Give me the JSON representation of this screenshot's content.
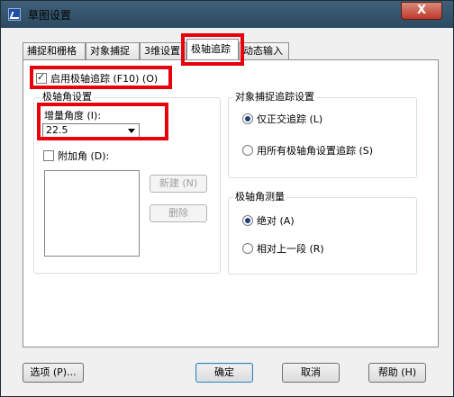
{
  "window": {
    "title": "草图设置",
    "close_glyph": "X"
  },
  "tabs": [
    {
      "label": "捕捉和栅格"
    },
    {
      "label": "对象捕捉"
    },
    {
      "label": "3维设置"
    },
    {
      "label": "极轴追踪"
    },
    {
      "label": "动态输入"
    }
  ],
  "polar": {
    "enable_label": "启用极轴追踪 (F10) (O)",
    "enable_checked": true,
    "angle_group_label": "极轴角设置",
    "increment_label": "增量角度 (I):",
    "increment_value": "22.5",
    "additional_label": "附加角 (D):",
    "additional_checked": false,
    "new_button": "新建 (N)",
    "delete_button": "删除"
  },
  "osnap_tracking": {
    "group_label": "对象捕捉追踪设置",
    "options": [
      {
        "label": "仅正交追踪 (L)",
        "selected": true
      },
      {
        "label": "用所有极轴角设置追踪 (S)",
        "selected": false
      }
    ]
  },
  "measurement": {
    "group_label": "极轴角测量",
    "options": [
      {
        "label": "绝对 (A)",
        "selected": true
      },
      {
        "label": "相对上一段 (R)",
        "selected": false
      }
    ]
  },
  "footer": {
    "options_button": "选项 (P)...",
    "ok_button": "确定",
    "cancel_button": "取消",
    "help_button": "帮助 (H)"
  },
  "colors": {
    "highlight": "#e8000b",
    "titlebar": "#2c4a61"
  }
}
